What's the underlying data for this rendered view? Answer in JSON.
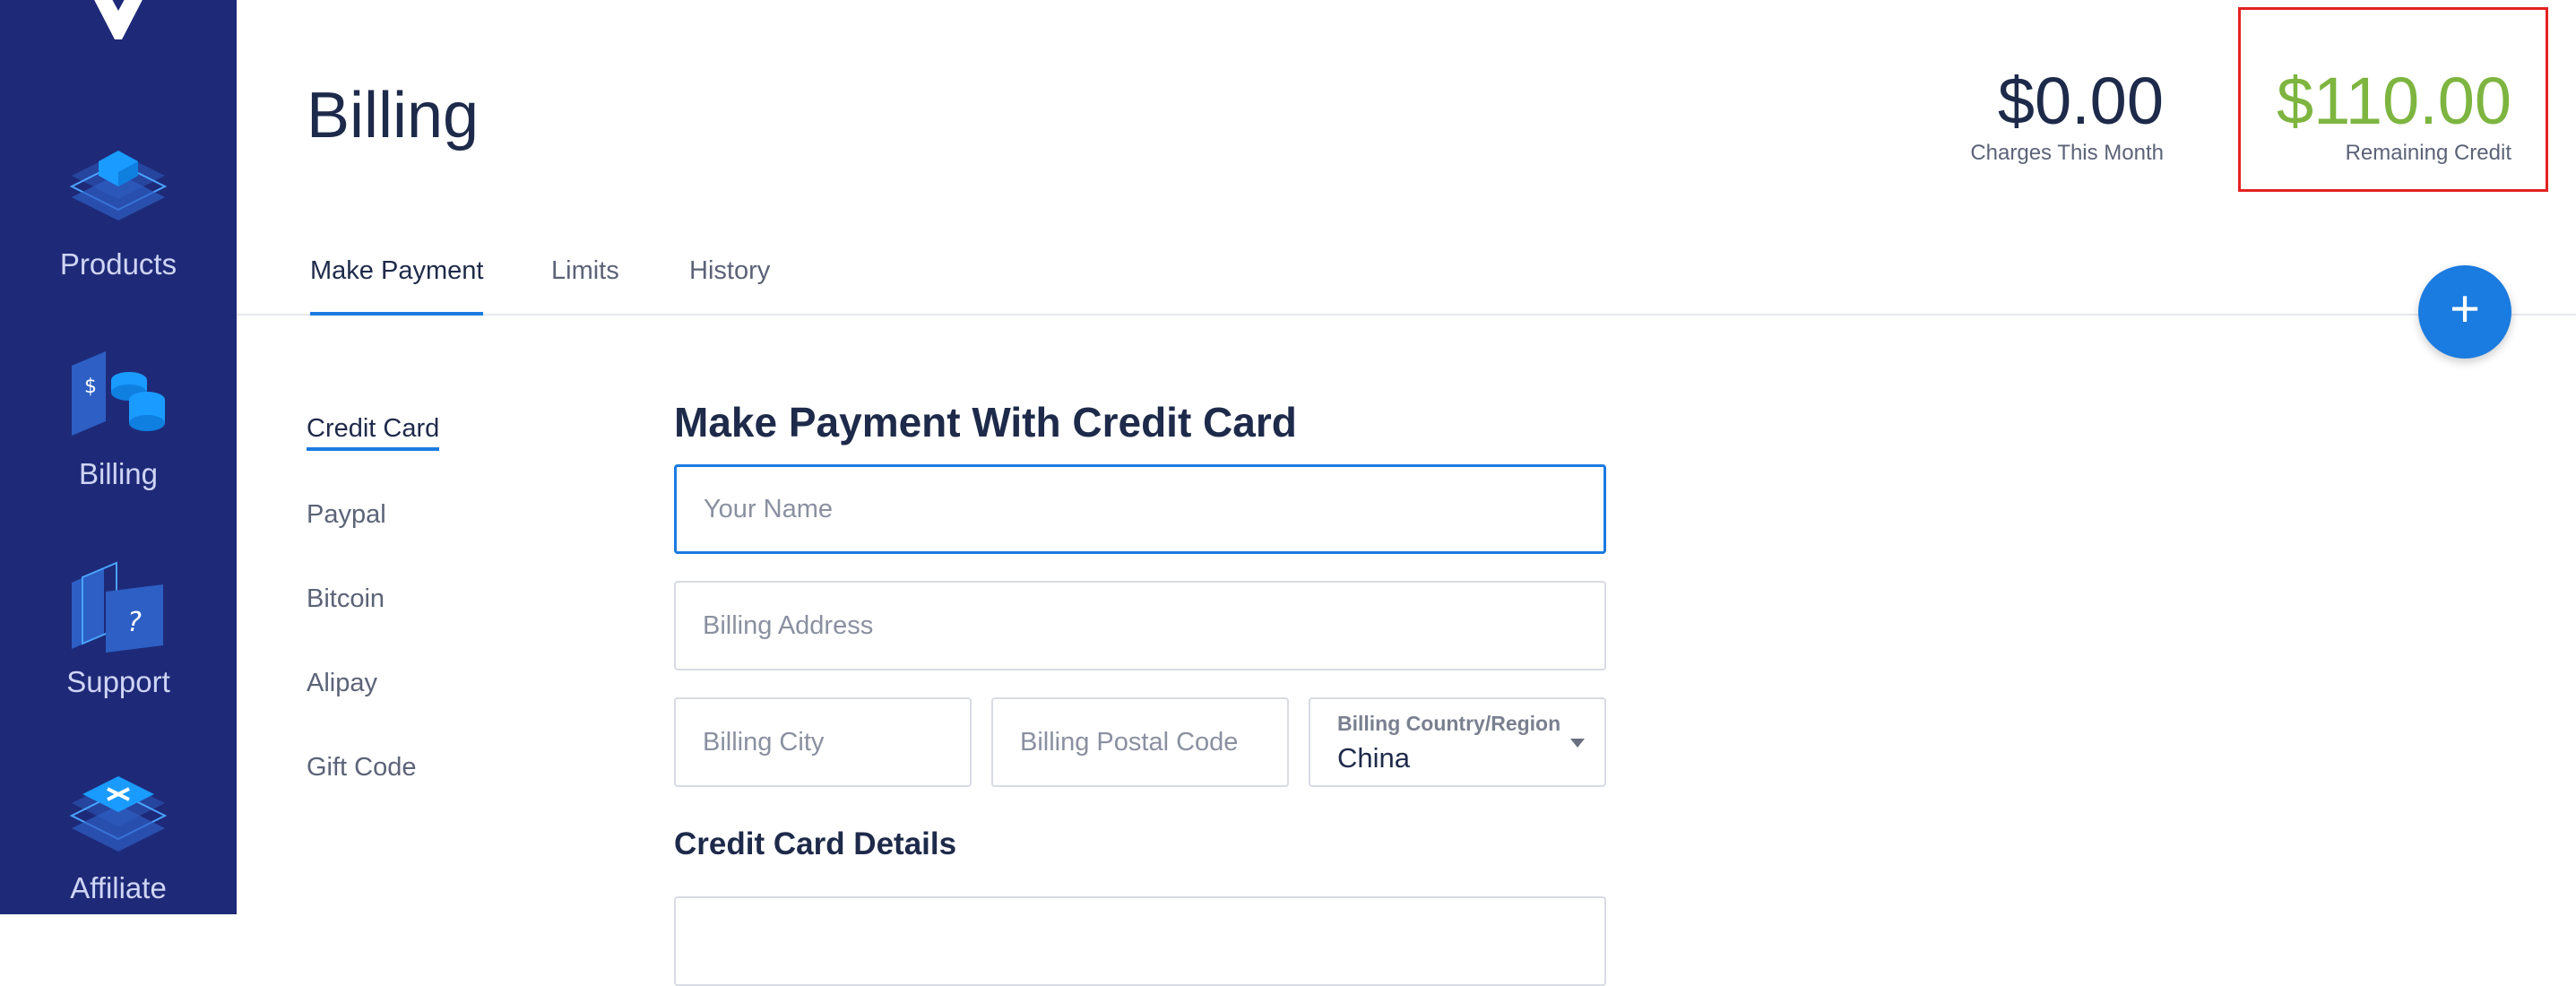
{
  "sidebar": {
    "items": [
      {
        "label": "Products",
        "icon": "products-icon"
      },
      {
        "label": "Billing",
        "icon": "billing-icon"
      },
      {
        "label": "Support",
        "icon": "support-icon"
      },
      {
        "label": "Affiliate",
        "icon": "affiliate-icon"
      }
    ],
    "background": "#1e2a78"
  },
  "header": {
    "title": "Billing",
    "charges": {
      "amount": "$0.00",
      "caption": "Charges This Month"
    },
    "credit": {
      "amount": "$110.00",
      "caption": "Remaining Credit",
      "color": "#7db540"
    }
  },
  "tabs": [
    {
      "label": "Make Payment",
      "active": true
    },
    {
      "label": "Limits",
      "active": false
    },
    {
      "label": "History",
      "active": false
    }
  ],
  "fab": {
    "label": "+"
  },
  "payment_methods": [
    {
      "label": "Credit Card",
      "active": true
    },
    {
      "label": "Paypal",
      "active": false
    },
    {
      "label": "Bitcoin",
      "active": false
    },
    {
      "label": "Alipay",
      "active": false
    },
    {
      "label": "Gift Code",
      "active": false
    }
  ],
  "form": {
    "title": "Make Payment With Credit Card",
    "name_placeholder": "Your Name",
    "address_placeholder": "Billing Address",
    "city_placeholder": "Billing City",
    "postal_placeholder": "Billing Postal Code",
    "country_label": "Billing Country/Region",
    "country_value": "China",
    "details_title": "Credit Card Details"
  },
  "accent_color": "#1a7be0"
}
